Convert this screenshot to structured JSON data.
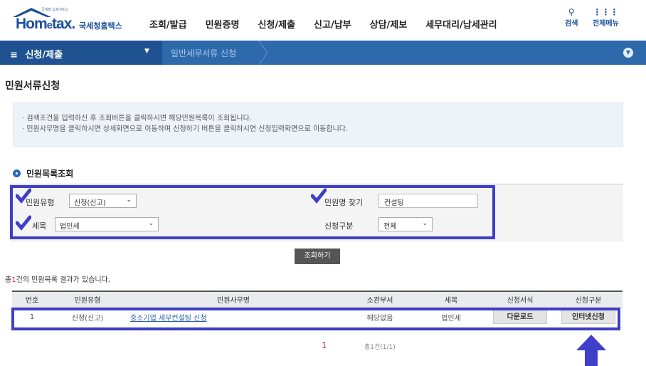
{
  "header": {
    "logo_small": "국세청 납세서비스",
    "logo_main": "Hom",
    "logo_e": "e",
    "logo_tax": "tax.",
    "logo_kor": "국세청홈택스",
    "nav": [
      "조회/발급",
      "민원증명",
      "신청/제출",
      "신고/납부",
      "상담/제보",
      "세무대리/납세관리"
    ],
    "search_label": "검색",
    "allmenu_label": "전체메뉴"
  },
  "navbar": {
    "menu_label": "신청/제출",
    "breadcrumb": "일반세무서류 신청"
  },
  "page": {
    "title": "민원서류신청",
    "notice": [
      "· 검색조건을 입력하신 후 조회버튼을 클릭하시면 해당민원목록이 조회됩니다.",
      "· 민원사무명을 클릭하시면 상세화면으로 이동하며  신청하기 버튼을 클릭하시면 신청입력화면으로 이동합니다."
    ],
    "section_title": "민원목록조회"
  },
  "search": {
    "type_label": "민원유형",
    "type_value": "신청(신고)",
    "name_label": "민원명 찾기",
    "name_value": "컨설팅",
    "tax_label": "세목",
    "tax_value": "법인세",
    "apply_label": "신청구분",
    "apply_value": "전체",
    "button": "조회하기"
  },
  "result": {
    "prefix": "총",
    "count": "1",
    "suffix": "건의 민원목록 결과가 있습니다."
  },
  "table": {
    "headers": [
      "번호",
      "민원유형",
      "민원사무명",
      "소관부서",
      "세목",
      "신청서식",
      "신청구분"
    ],
    "rows": [
      {
        "no": "1",
        "type": "신청(신고)",
        "name": "중소기업 세무컨설팅 신청",
        "dept": "해당없음",
        "tax": "법인세",
        "form_button": "다운로드",
        "apply_button": "인터넷신청"
      }
    ]
  },
  "pager": {
    "current": "1",
    "info": "총1건(1/1)"
  },
  "colors": {
    "highlight": "#3f3fc9",
    "navbar": "#2e6aab",
    "brand": "#1b4f9c"
  }
}
